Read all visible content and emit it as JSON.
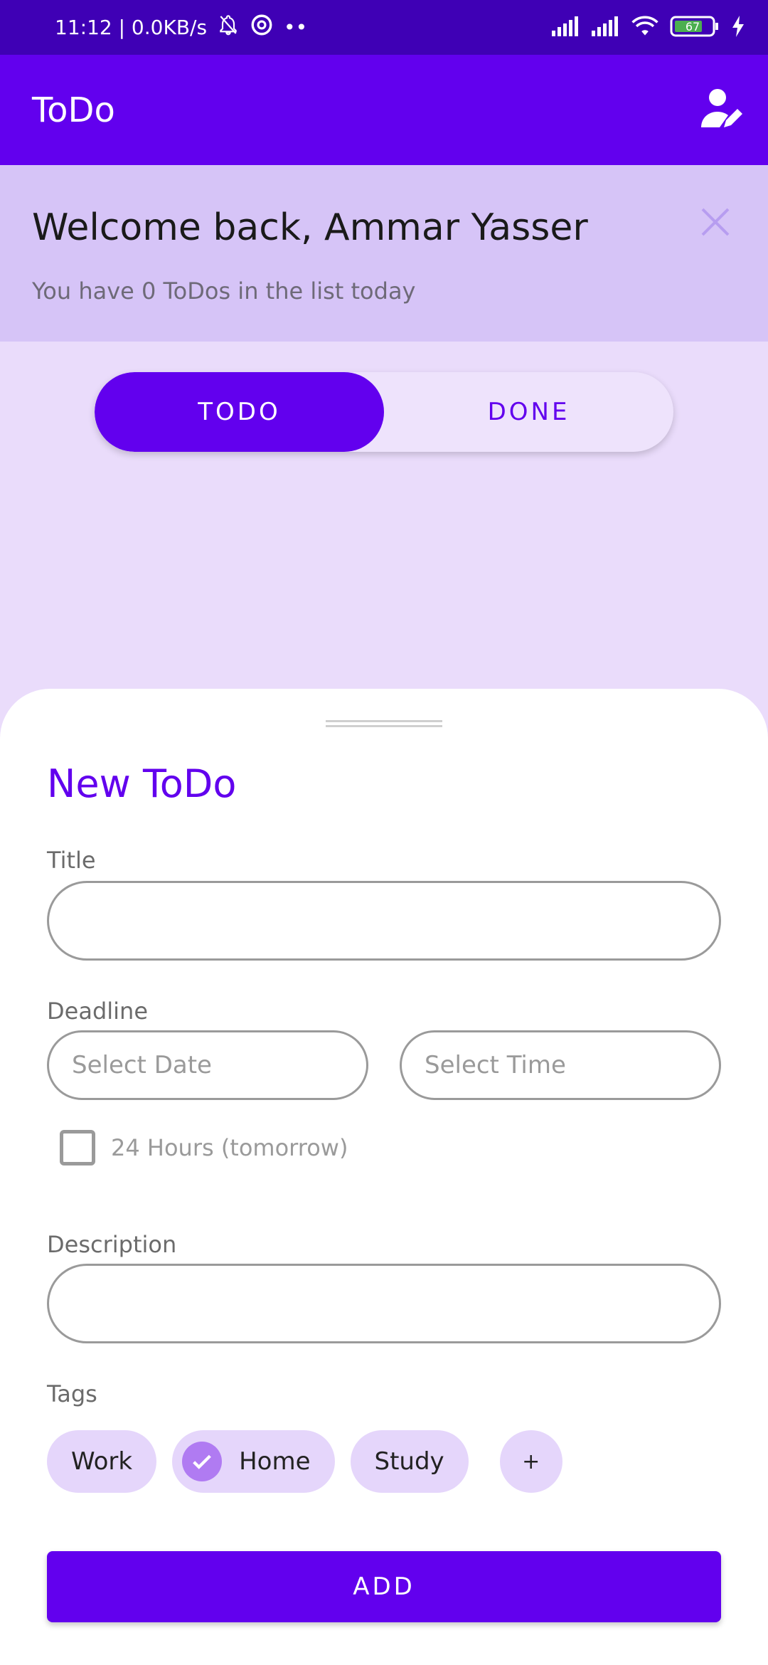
{
  "status_bar": {
    "time_speed": "11:12 | 0.0KB/s",
    "dots": "••",
    "battery": "67"
  },
  "app_bar": {
    "title": "ToDo",
    "profile_icon": "person-edit-icon"
  },
  "banner": {
    "welcome": "Welcome back, Ammar Yasser",
    "subtitle": "You have 0 ToDos in the list today",
    "close_icon": "close-icon"
  },
  "segment": {
    "todo_label": "TODO",
    "done_label": "DONE",
    "selected": "TODO"
  },
  "sheet": {
    "title": "New ToDo",
    "title_label": "Title",
    "title_value": "",
    "deadline_label": "Deadline",
    "date_placeholder": "Select Date",
    "time_placeholder": "Select Time",
    "checkbox_label": "24 Hours (tomorrow)",
    "checkbox_checked": false,
    "description_label": "Description",
    "description_value": "",
    "tags_label": "Tags",
    "tags": [
      {
        "label": "Work",
        "selected": false
      },
      {
        "label": "Home",
        "selected": true
      },
      {
        "label": "Study",
        "selected": false
      }
    ],
    "add_tag_label": "+",
    "add_button_label": "ADD"
  },
  "colors": {
    "primary": "#6200EE",
    "status_bar": "#3F00B5",
    "banner_bg": "#D6C4F7",
    "page_bg": "#EADCFB",
    "chip_bg": "#E5D6FB"
  }
}
